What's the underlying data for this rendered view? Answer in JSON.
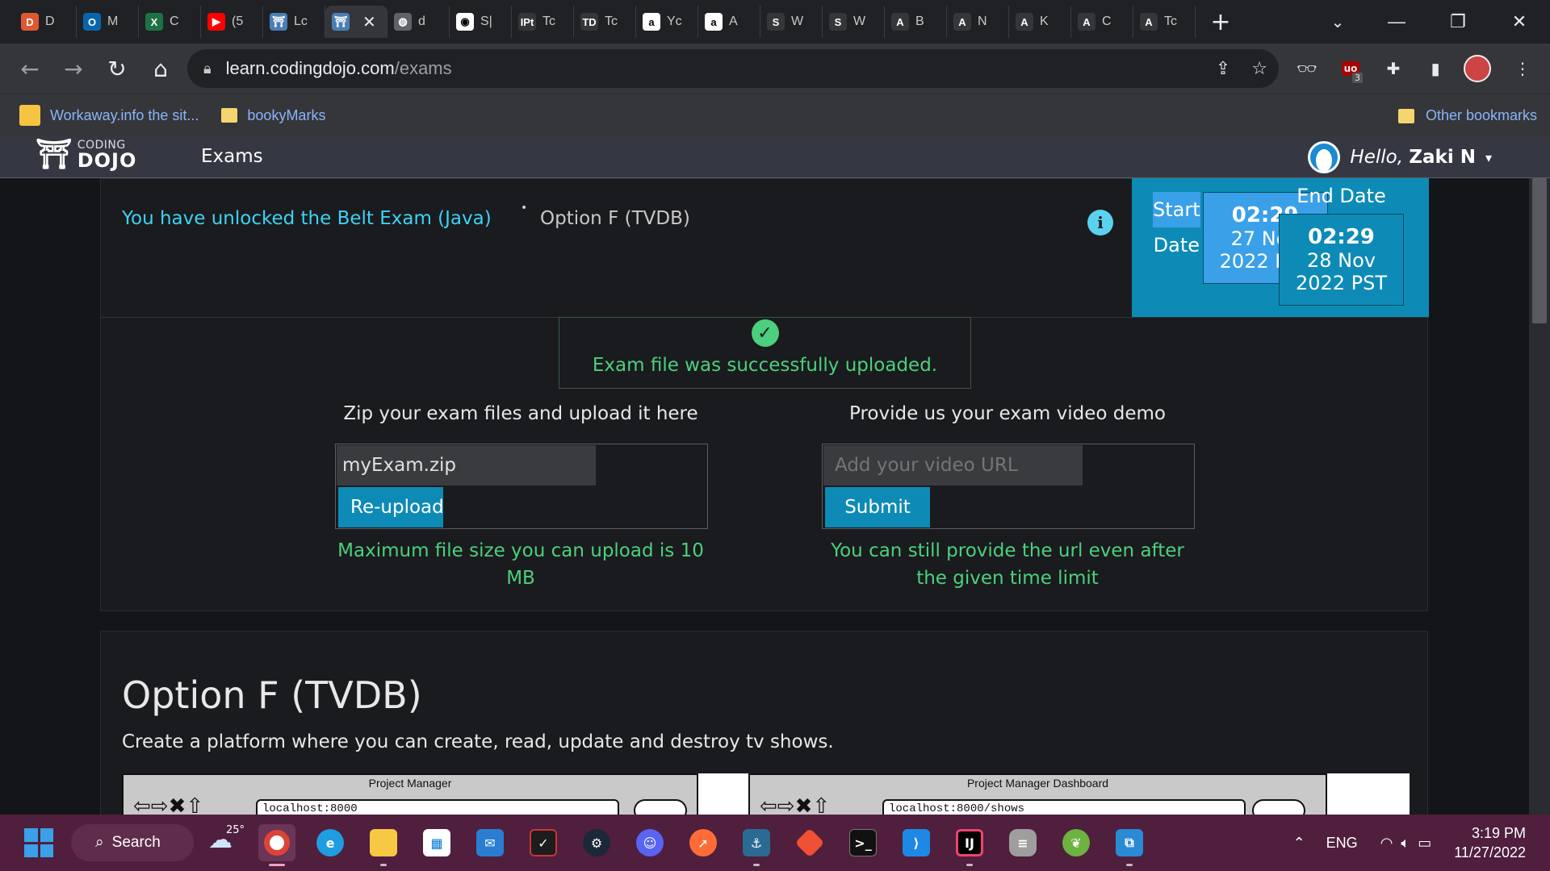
{
  "browser": {
    "tabs": [
      {
        "label": "D",
        "icon": "duckduckgo-icon",
        "color": "#de5833",
        "glyph": "D"
      },
      {
        "label": "M",
        "icon": "outlook-icon",
        "color": "#0a64ad",
        "glyph": "O"
      },
      {
        "label": "C",
        "icon": "excel-icon",
        "color": "#1e7145",
        "glyph": "X"
      },
      {
        "label": "(5",
        "icon": "youtube-icon",
        "color": "#ff0000",
        "glyph": "▶"
      },
      {
        "label": "Lc",
        "icon": "coding-dojo-icon",
        "color": "#4a7fb5",
        "glyph": "⛩"
      },
      {
        "label": "",
        "icon": "coding-dojo-icon",
        "color": "#4a7fb5",
        "glyph": "⛩",
        "active": true
      },
      {
        "label": "d",
        "icon": "globe-icon",
        "color": "#5f6368",
        "glyph": "◍"
      },
      {
        "label": "S|",
        "icon": "github-icon",
        "color": "#ffffff",
        "glyph": "◉"
      },
      {
        "label": "Tc",
        "icon": "ipt-icon",
        "color": "#35363a",
        "glyph": "IPt"
      },
      {
        "label": "Tc",
        "icon": "td-icon",
        "color": "#35363a",
        "glyph": "TD"
      },
      {
        "label": "Yc",
        "icon": "amazon-icon",
        "color": "#ffffff",
        "glyph": "a"
      },
      {
        "label": "A",
        "icon": "amazon-icon",
        "color": "#ffffff",
        "glyph": "a"
      },
      {
        "label": "W",
        "icon": "swagger-icon",
        "color": "#35363a",
        "glyph": "S"
      },
      {
        "label": "W",
        "icon": "swagger-icon",
        "color": "#35363a",
        "glyph": "S"
      },
      {
        "label": "B",
        "icon": "azure-icon",
        "color": "#35363a",
        "glyph": "A"
      },
      {
        "label": "N",
        "icon": "azure-icon",
        "color": "#35363a",
        "glyph": "A"
      },
      {
        "label": "K",
        "icon": "azure-icon",
        "color": "#35363a",
        "glyph": "A"
      },
      {
        "label": "C",
        "icon": "azure-icon",
        "color": "#35363a",
        "glyph": "A"
      },
      {
        "label": "Tc",
        "icon": "azure-icon",
        "color": "#35363a",
        "glyph": "A"
      }
    ],
    "url_host": "learn.codingdojo.com",
    "url_path": "/exams",
    "bookmarks": [
      {
        "label": "Workaway.info the sit...",
        "icon": "workaway-icon"
      },
      {
        "label": "bookyMarks",
        "icon": "folder-icon"
      }
    ],
    "other_bookmarks": "Other bookmarks",
    "extension_badge": "3"
  },
  "site": {
    "logo_small": "CODING",
    "logo_big": "DOJO",
    "nav_exams": "Exams",
    "greeting": "Hello,",
    "user_name": "Zaki N",
    "caret": "▾"
  },
  "exam": {
    "unlocked_text": "You have unlocked the Belt Exam (Java)",
    "bullet": "•",
    "option_label": "Option F (TVDB)",
    "info": "i",
    "start_head": "Start Date",
    "end_head": "End Date",
    "start_time": "02:29",
    "start_day": "27 Nov",
    "start_year_tz": "2022 PST",
    "end_time": "02:29",
    "end_day": "28 Nov",
    "end_year_tz": "2022 PST",
    "success_message": "Exam file was successfully uploaded.",
    "zip_title": "Zip your exam files and upload it here",
    "file_name": "myExam.zip",
    "reupload_label": "Re-upload",
    "zip_hint": "Maximum file size you can upload is 10 MB",
    "video_title": "Provide us your exam video demo",
    "video_placeholder": "Add your video URL",
    "submit_label": "Submit",
    "video_hint": "You can still provide the url even after the given time limit"
  },
  "project": {
    "title": "Option F (TVDB)",
    "description": "Create a platform where you can create, read, update and destroy tv shows.",
    "wire1_title": "Project Manager",
    "wire1_url": "localhost:8000",
    "wire2_title": "Project Manager Dashboard",
    "wire2_url": "localhost:8000/shows"
  },
  "taskbar": {
    "search_label": "Search",
    "weather_temp": "25°",
    "language": "ENG",
    "time": "3:19 PM",
    "date": "11/27/2022"
  },
  "colors": {
    "accent_blue": "#0d8bb6",
    "success_green": "#4cd07d",
    "link_cyan": "#3bd3f3",
    "taskbar": "#4f1f3d"
  }
}
